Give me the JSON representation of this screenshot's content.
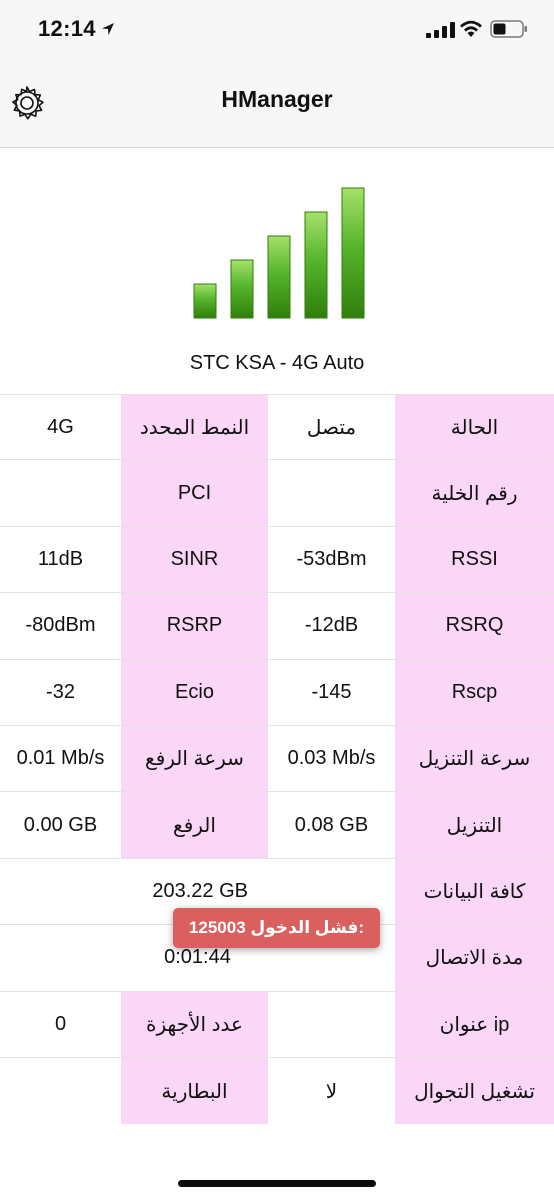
{
  "status_bar": {
    "time": "12:14",
    "icons": [
      "location-arrow-icon",
      "cellular-signal-icon",
      "wifi-icon",
      "battery-icon"
    ]
  },
  "nav": {
    "title": "HManager",
    "settings_icon": "gear-icon"
  },
  "signal": {
    "bars_total": 5,
    "bars_active": 5,
    "color": "#3d9a10",
    "label": "STC KSA - 4G Auto"
  },
  "table": {
    "rows": [
      [
        "الحالة",
        "متصل",
        "النمط المحدد",
        "4G"
      ],
      [
        "رقم الخلية",
        "",
        "PCI",
        ""
      ],
      [
        "RSSI",
        "-53dBm",
        "SINR",
        "11dB"
      ],
      [
        "RSRQ",
        "-12dB",
        "RSRP",
        "-80dBm"
      ],
      [
        "Rscp",
        "-145",
        "Ecio",
        "-32"
      ],
      [
        "سرعة التنزيل",
        "0.03 Mb/s",
        "سرعة الرفع",
        "0.01 Mb/s"
      ],
      [
        "التنزيل",
        "0.08 GB",
        "الرفع",
        "0.00 GB"
      ]
    ],
    "total": {
      "label": "كافة البيانات",
      "value": "203.22 GB"
    },
    "duration": {
      "label": "مدة الاتصال",
      "value": "0:01:44"
    },
    "rows_bottom": [
      [
        "عنوان ip",
        "",
        "عدد الأجهزة",
        "0"
      ],
      [
        "تشغيل التجوال",
        "لا",
        "البطارية",
        ""
      ]
    ],
    "label_color": "#fad6f7"
  },
  "toast": {
    "text": "125003 فشل الدخول:",
    "color": "#d9605f"
  }
}
